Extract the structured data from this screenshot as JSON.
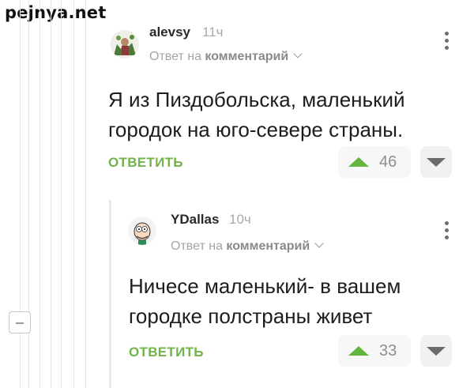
{
  "watermark": "pejnya.net",
  "comments": [
    {
      "username": "alevsy",
      "time": "11ч",
      "reply_to_prefix": "Ответ на",
      "reply_to_target": "комментарий",
      "text_lines": [
        "Я из Пиздобольска, маленький",
        "городок на юго-севере страны."
      ],
      "reply_label": "ОТВЕТИТЬ",
      "votes": "46"
    },
    {
      "username": "YDallas",
      "time": "10ч",
      "reply_to_prefix": "Ответ на",
      "reply_to_target": "комментарий",
      "text_lines": [
        "Ничесе маленький- в вашем",
        "городке полстраны живет"
      ],
      "reply_label": "ОТВЕТИТЬ",
      "votes": "33"
    }
  ],
  "colors": {
    "accent": "#72b34a",
    "upvote": "#63b53f"
  },
  "icons": [
    "kebab-menu-icon",
    "chevron-down-icon",
    "upvote-icon",
    "downvote-icon",
    "collapse-icon"
  ]
}
